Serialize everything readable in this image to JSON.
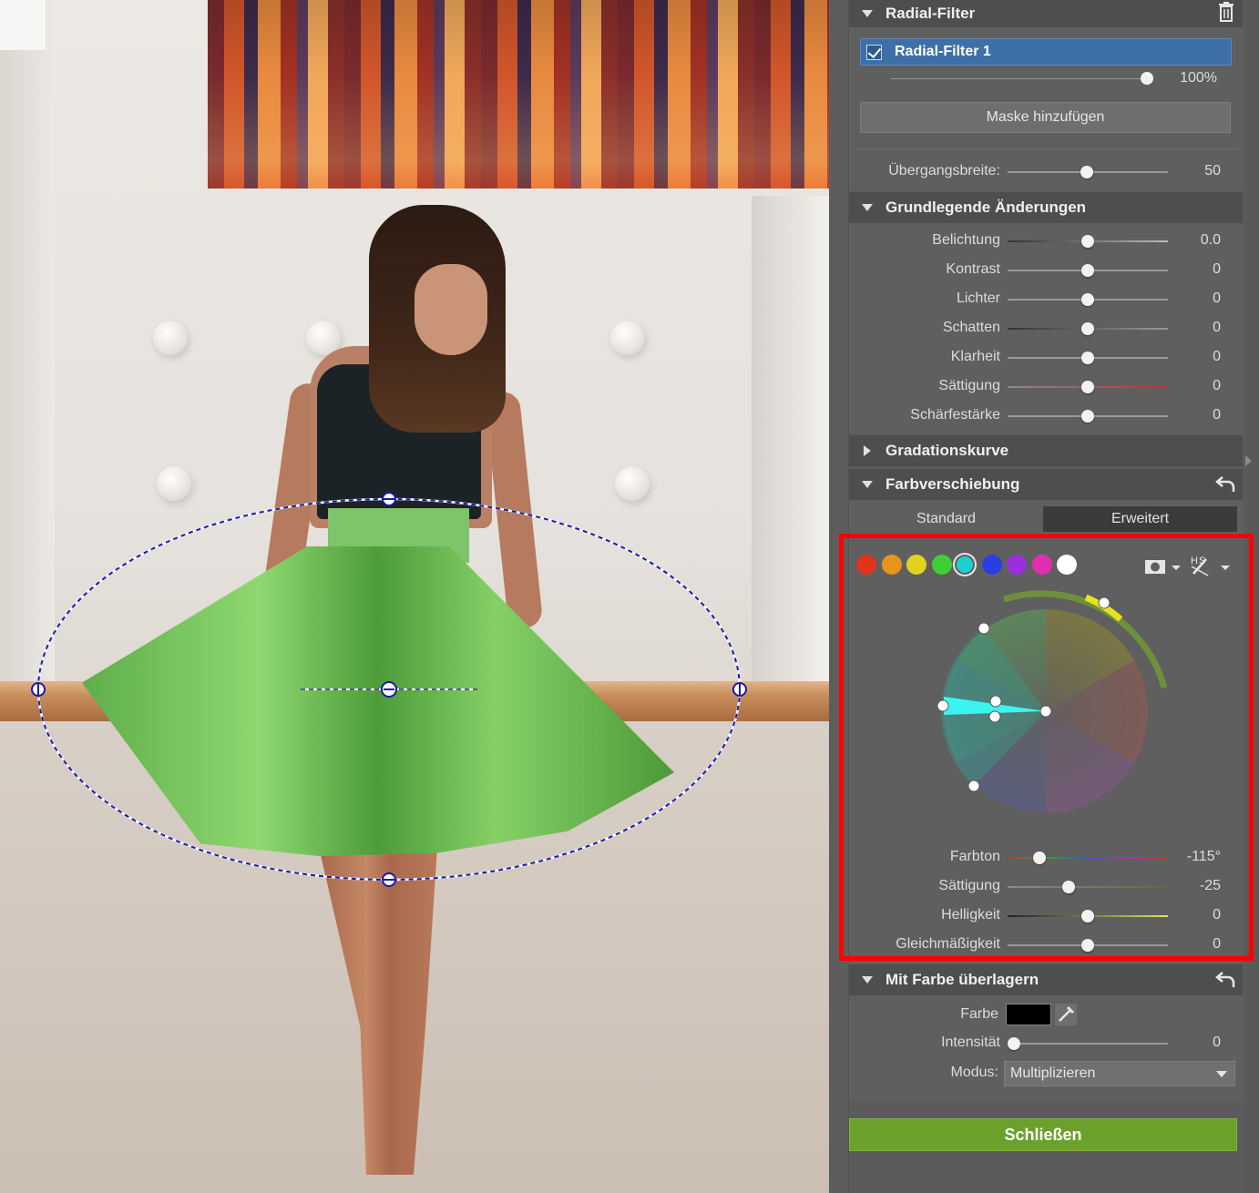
{
  "radial_filter": {
    "title": "Radial-Filter",
    "layer_name": "Radial-Filter 1",
    "opacity_label": "100%",
    "opacity_value": 100,
    "add_mask_label": "Maske hinzufügen",
    "transition": {
      "label": "Übergangsbreite:",
      "value": "50",
      "position": 0.5
    }
  },
  "basic": {
    "title": "Grundlegende Änderungen",
    "sliders": [
      {
        "label": "Belichtung",
        "value": "0.0",
        "position": 0.5
      },
      {
        "label": "Kontrast",
        "value": "0",
        "position": 0.5
      },
      {
        "label": "Lichter",
        "value": "0",
        "position": 0.5
      },
      {
        "label": "Schatten",
        "value": "0",
        "position": 0.5
      },
      {
        "label": "Klarheit",
        "value": "0",
        "position": 0.5
      },
      {
        "label": "Sättigung",
        "value": "0",
        "position": 0.5
      },
      {
        "label": "Schärfestärke",
        "value": "0",
        "position": 0.5
      }
    ]
  },
  "curve": {
    "title": "Gradationskurve"
  },
  "color_shift": {
    "title": "Farbverschiebung",
    "tabs": [
      {
        "label": "Standard"
      },
      {
        "label": "Erweitert"
      }
    ],
    "active_tab": "Erweitert",
    "color_dots": [
      "#e0341a",
      "#e8941a",
      "#e3d21b",
      "#3fcf35",
      "#1ecfd0",
      "#2b3fe0",
      "#9a2fe0",
      "#e02fae",
      "#ffffff"
    ],
    "selected_dot": 4,
    "sliders": [
      {
        "label": "Farbton",
        "value": "-115°",
        "position": 0.2
      },
      {
        "label": "Sättigung",
        "value": "-25",
        "position": 0.38
      },
      {
        "label": "Helligkeit",
        "value": "0",
        "position": 0.5
      },
      {
        "label": "Gleichmäßigkeit",
        "value": "0",
        "position": 0.5
      }
    ]
  },
  "overlay": {
    "title": "Mit Farbe überlagern",
    "color_label": "Farbe",
    "color_value": "#000000",
    "intensity": {
      "label": "Intensität",
      "value": "0",
      "position": 0.0
    },
    "mode_label": "Modus:",
    "mode_value": "Multiplizieren"
  },
  "close_label": "Schließen",
  "colors": {
    "accent": "#6ba02a",
    "selection": "#3f6fa8",
    "highlight": "#ff0000",
    "ellipse": "#1a1aa8"
  }
}
